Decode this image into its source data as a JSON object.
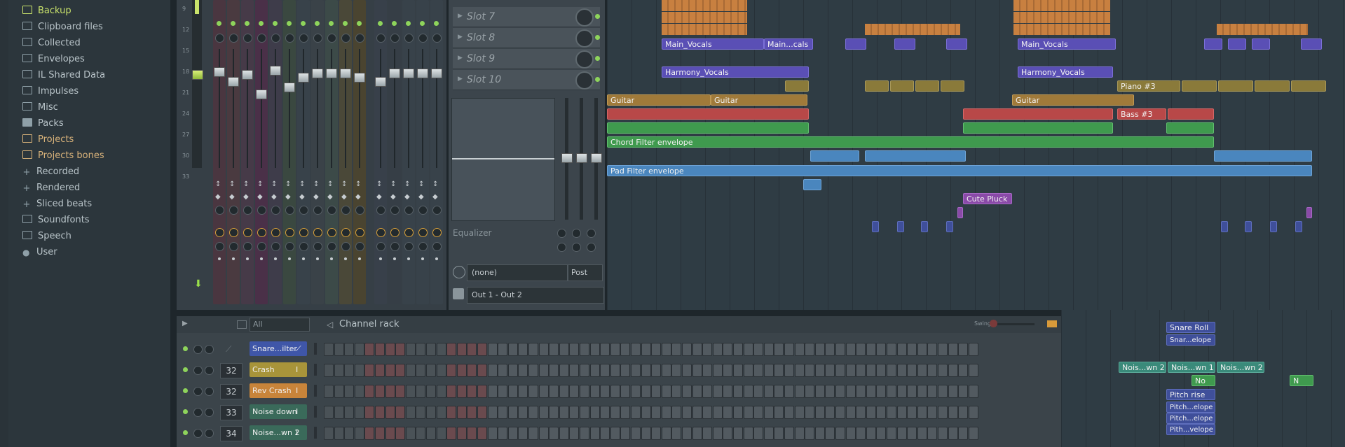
{
  "browser": {
    "items": [
      {
        "label": "Backup",
        "icon": "folder-icon",
        "state": "selected"
      },
      {
        "label": "Clipboard files",
        "icon": "folder-icon"
      },
      {
        "label": "Collected",
        "icon": "folder-icon"
      },
      {
        "label": "Envelopes",
        "icon": "folder-icon"
      },
      {
        "label": "IL Shared Data",
        "icon": "folder-icon"
      },
      {
        "label": "Impulses",
        "icon": "folder-icon"
      },
      {
        "label": "Misc",
        "icon": "folder-icon"
      },
      {
        "label": "Packs",
        "icon": "pack-icon"
      },
      {
        "label": "Projects",
        "icon": "folder-icon",
        "state": "warm"
      },
      {
        "label": "Projects bones",
        "icon": "folder-icon",
        "state": "warm"
      },
      {
        "label": "Recorded",
        "icon": "plus-icon"
      },
      {
        "label": "Rendered",
        "icon": "plus-icon"
      },
      {
        "label": "Sliced beats",
        "icon": "plus-icon"
      },
      {
        "label": "Soundfonts",
        "icon": "folder-icon"
      },
      {
        "label": "Speech",
        "icon": "folder-icon"
      },
      {
        "label": "User",
        "icon": "user-icon"
      }
    ]
  },
  "mixer": {
    "scale": [
      "9",
      "12",
      "15",
      "18",
      "21",
      "24",
      "27",
      "30",
      "33"
    ]
  },
  "slots": {
    "items": [
      "Slot 7",
      "Slot 8",
      "Slot 9",
      "Slot 10"
    ],
    "equalizer_label": "Equalizer",
    "send_value": "(none)",
    "send_mode": "Post",
    "output": "Out 1 - Out 2"
  },
  "playlist": {
    "clips": {
      "main_vocals_1": "Main_Vocals",
      "main_cals": "Main...cals",
      "main_vocals_2": "Main_Vocals",
      "harmony_1": "Harmony_Vocals",
      "harmony_2": "Harmony_Vocals",
      "guitar_1": "Guitar",
      "guitar_2": "Guitar",
      "guitar_3": "Guitar",
      "bass3": "Bass #3",
      "piano3": "Piano #3",
      "chord_env": "Chord Filter envelope",
      "pad_env": "Pad Filter envelope",
      "cute_pluck": "Cute Pluck",
      "snare_roll": "Snare Roll",
      "snare_elope": "Snar...elope",
      "nois_wn2a": "Nois...wn 2",
      "nois_wn1": "Nois...wn 1",
      "nois_wn2b": "Nois...wn 2",
      "pitch_rise": "Pitch rise",
      "pitch_elope_1": "Pitch...elope",
      "pitch_elope_2": "Pitch...elope",
      "pith_velope": "Pith...velope",
      "small_no": "No",
      "small_n": "N"
    }
  },
  "rack": {
    "filter": "All",
    "title": "Channel rack",
    "swing_label": "Swing",
    "channels": [
      {
        "name": "Snare...ilter",
        "number": "",
        "color": "#3f56a8",
        "icon": "envelope-icon"
      },
      {
        "name": "Crash",
        "number": "32",
        "color": "#a8943a",
        "icon": "sample-icon"
      },
      {
        "name": "Rev Crash",
        "number": "32",
        "color": "#c8843a",
        "icon": "sample-icon"
      },
      {
        "name": "Noise down",
        "number": "33",
        "color": "#3a6a5a",
        "icon": "sample-icon"
      },
      {
        "name": "Noise...wn 2",
        "number": "34",
        "color": "#3a6a5a",
        "icon": "sample-icon"
      }
    ]
  },
  "colors": {
    "accent_green": "#8ed45b",
    "vocal_clip": "#5a4fb5",
    "guitar_clip": "#a07a3a",
    "bass_clip": "#b84848",
    "chord_clip": "#3f9a4e",
    "pad_clip": "#4a86be"
  }
}
